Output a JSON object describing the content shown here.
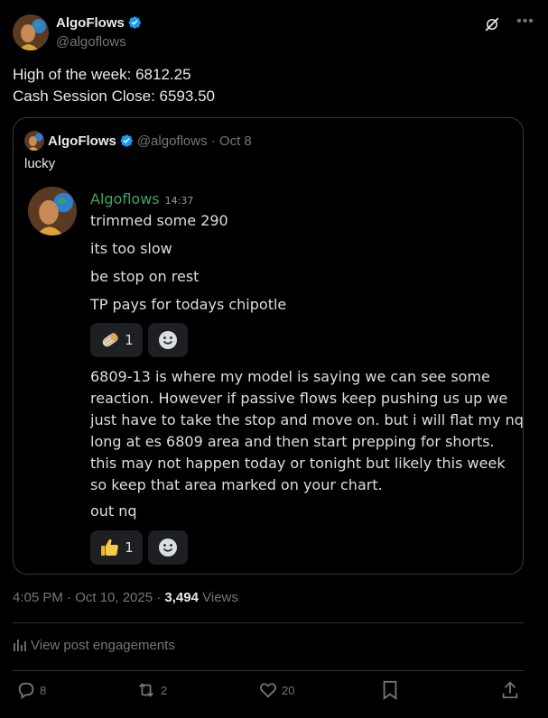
{
  "author": {
    "name": "AlgoFlows",
    "handle": "@algoflows"
  },
  "post": {
    "lines": [
      "High of the week: 6812.25",
      "Cash Session Close: 6593.50"
    ]
  },
  "quote": {
    "name": "AlgoFlows",
    "handle_date": "@algoflows · Oct 8",
    "text": "lucky",
    "discord": {
      "username": "Algoflows",
      "time": "14:37",
      "lines": [
        "trimmed some 290",
        "its too slow",
        "be stop on rest",
        "TP pays for todays chipotle"
      ],
      "reaction1": {
        "emoji_icon": "burrito-icon",
        "count": "1"
      },
      "paragraph": [
        "6809-13 is where my model is saying we can see some",
        "reaction. However if passive flows keep pushing us up we",
        "just have to take the stop and move on. but i will flat my nq",
        "long at es 6809 area and then start prepping for shorts.",
        "this may not happen today or tonight but likely this week",
        "so keep that area marked on your chart."
      ],
      "last_line": "out nq",
      "reaction2": {
        "emoji_icon": "thumbs-up-icon",
        "count": "1"
      }
    }
  },
  "meta": {
    "timestamp": "4:05 PM · Oct 10, 2025 · ",
    "views_count": "3,494",
    "views_label": " Views"
  },
  "engagements_label": "View post engagements",
  "actions": {
    "replies": "8",
    "reposts": "2",
    "likes": "20"
  },
  "colors": {
    "background": "#000000",
    "verified": "#1d9bf0",
    "discord_name": "#3ba55c",
    "muted": "#71767b"
  }
}
